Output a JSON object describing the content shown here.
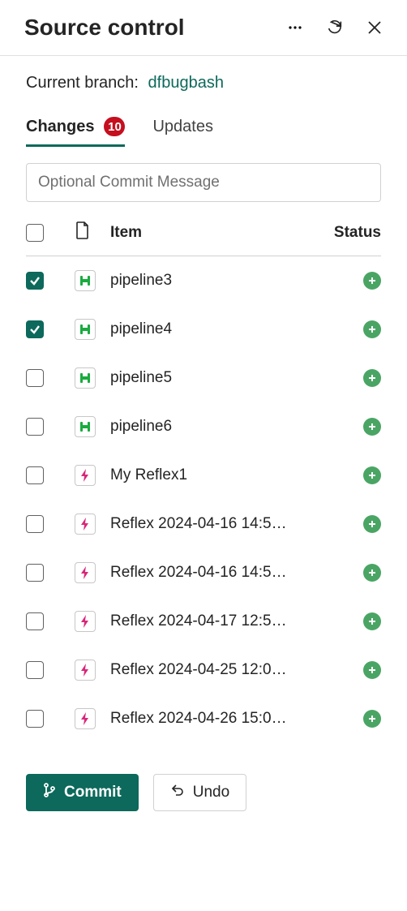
{
  "header": {
    "title": "Source control"
  },
  "branch": {
    "label": "Current branch:",
    "name": "dfbugbash"
  },
  "tabs": {
    "changes": {
      "label": "Changes",
      "badge": "10"
    },
    "updates": {
      "label": "Updates"
    }
  },
  "commit_input": {
    "placeholder": "Optional Commit Message",
    "value": ""
  },
  "columns": {
    "item": "Item",
    "status": "Status"
  },
  "items": [
    {
      "checked": true,
      "type": "pipeline",
      "name": "pipeline3",
      "status": "added"
    },
    {
      "checked": true,
      "type": "pipeline",
      "name": "pipeline4",
      "status": "added"
    },
    {
      "checked": false,
      "type": "pipeline",
      "name": "pipeline5",
      "status": "added"
    },
    {
      "checked": false,
      "type": "pipeline",
      "name": "pipeline6",
      "status": "added"
    },
    {
      "checked": false,
      "type": "reflex",
      "name": "My Reflex1",
      "status": "added"
    },
    {
      "checked": false,
      "type": "reflex",
      "name": "Reflex 2024-04-16 14:5…",
      "status": "added"
    },
    {
      "checked": false,
      "type": "reflex",
      "name": "Reflex 2024-04-16 14:5…",
      "status": "added"
    },
    {
      "checked": false,
      "type": "reflex",
      "name": "Reflex 2024-04-17 12:5…",
      "status": "added"
    },
    {
      "checked": false,
      "type": "reflex",
      "name": "Reflex 2024-04-25 12:0…",
      "status": "added"
    },
    {
      "checked": false,
      "type": "reflex",
      "name": "Reflex 2024-04-26 15:0…",
      "status": "added"
    }
  ],
  "footer": {
    "commit": "Commit",
    "undo": "Undo"
  },
  "colors": {
    "accent": "#0c695b",
    "badge_red": "#c50f1f",
    "status_green": "#4aa564",
    "reflex_pink": "#d8277a",
    "pipeline_green": "#1aab40"
  }
}
